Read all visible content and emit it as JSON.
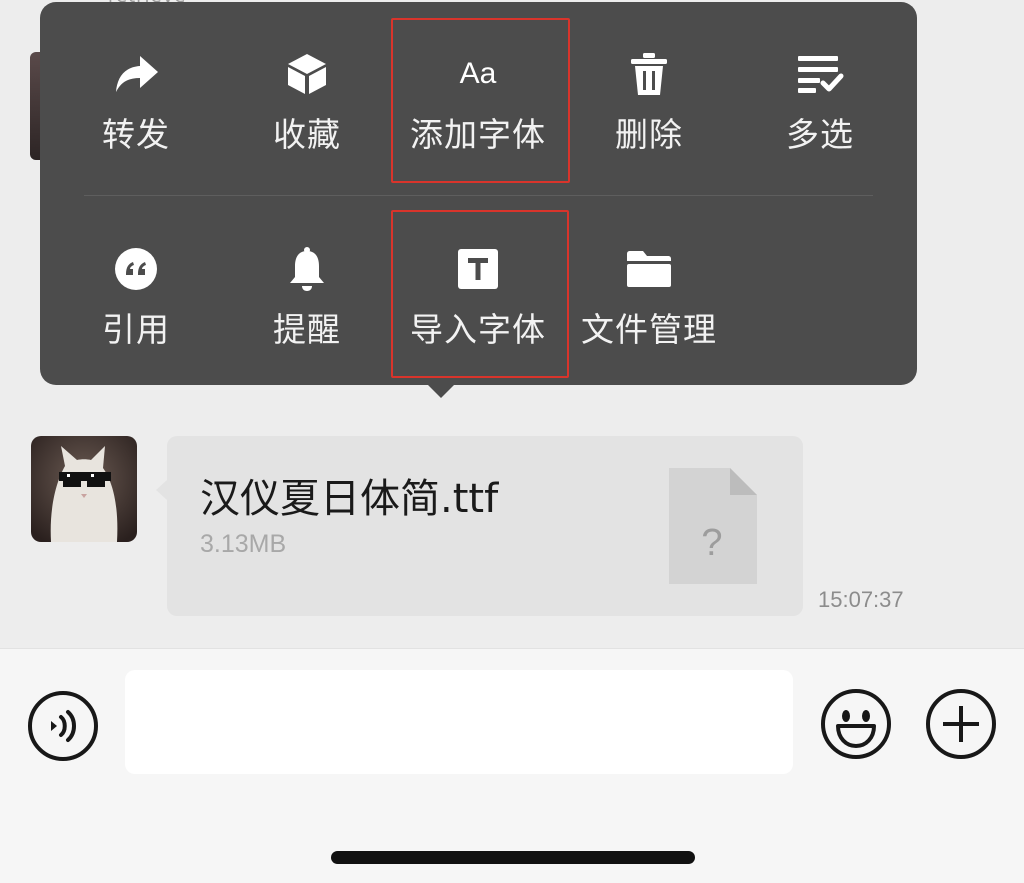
{
  "top_peek_text": "retrieve",
  "menu": {
    "row1": [
      {
        "label": "转发",
        "icon": "share-arrow-icon"
      },
      {
        "label": "收藏",
        "icon": "cube-icon"
      },
      {
        "label": "添加字体",
        "icon": "font-aa-icon",
        "glyph": "Aa"
      },
      {
        "label": "删除",
        "icon": "trash-icon"
      },
      {
        "label": "多选",
        "icon": "multi-select-icon"
      }
    ],
    "row2": [
      {
        "label": "引用",
        "icon": "quote-icon"
      },
      {
        "label": "提醒",
        "icon": "bell-icon"
      },
      {
        "label": "导入字体",
        "icon": "text-t-icon",
        "glyph": "T"
      },
      {
        "label": "文件管理",
        "icon": "folder-icon"
      }
    ]
  },
  "message": {
    "file_name": "汉仪夏日体简.ttf",
    "file_size": "3.13MB",
    "file_icon_glyph": "?",
    "timestamp": "15:07:37"
  },
  "input": {
    "placeholder": ""
  },
  "colors": {
    "menu_bg": "#4c4c4c",
    "highlight": "#d9342b",
    "bubble_bg": "#e3e3e3",
    "page_bg": "#ededed"
  }
}
